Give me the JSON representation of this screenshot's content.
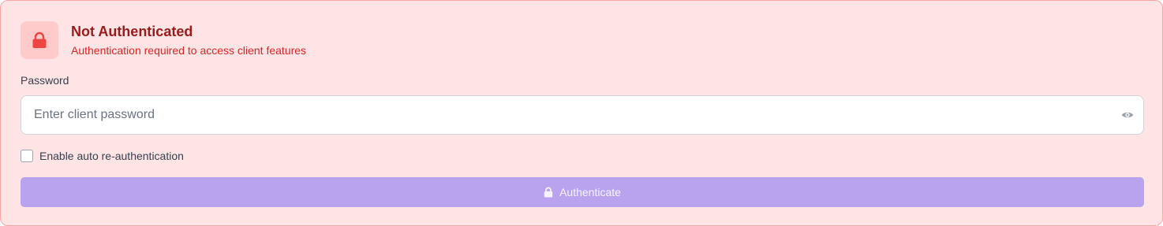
{
  "status": {
    "title": "Not Authenticated",
    "subtitle": "Authentication required to access client features",
    "icon": "lock-icon",
    "color": "#ef4444"
  },
  "password": {
    "label": "Password",
    "placeholder": "Enter client password",
    "value": "",
    "toggle_icon": "eye-icon"
  },
  "auto_reauth": {
    "label": "Enable auto re-authentication",
    "checked": false
  },
  "authenticate_button": {
    "label": "Authenticate",
    "icon": "lock-icon",
    "color": "#b9a3ef"
  }
}
